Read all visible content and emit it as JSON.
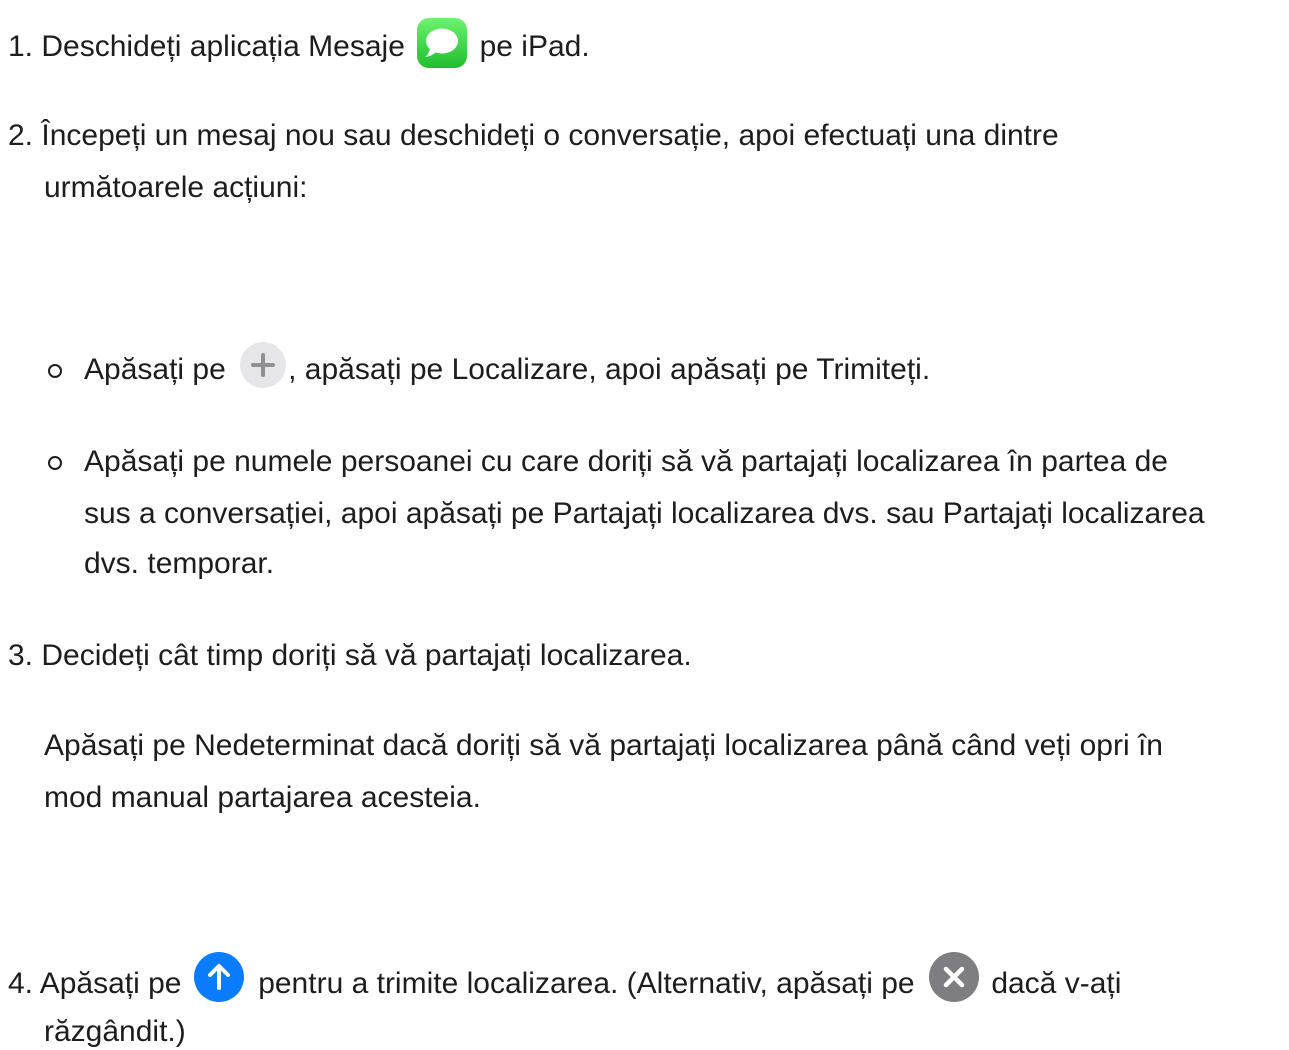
{
  "steps": [
    {
      "number": "1.",
      "before": "Deschideți aplicația Mesaje",
      "icon": "messages-app-icon",
      "after": "pe iPad."
    },
    {
      "number": "2.",
      "line1": "Începeți un mesaj nou sau deschideți o conversație, apoi efectuați una dintre",
      "line2": "următoarele acțiuni:",
      "options": [
        {
          "before": "Apăsați pe",
          "icon": "plus-icon",
          "after": ", apăsați pe Localizare, apoi apăsați pe Trimiteți."
        },
        {
          "line1": "Apăsați pe numele persoanei cu care doriți să vă partajați localizarea în partea de",
          "line2": "sus a conversației, apoi apăsați pe Partajați localizarea dvs. sau Partajați localizarea",
          "line3": "dvs. temporar."
        }
      ]
    },
    {
      "number": "3.",
      "text": "Decideți cât timp doriți să vă partajați localizarea.",
      "note_line1": "Apăsați pe Nedeterminat dacă doriți să vă partajați localizarea până când veți opri în",
      "note_line2": "mod manual partajarea acesteia."
    },
    {
      "number": "4.",
      "before": "Apăsați pe",
      "icon1": "send-arrow-icon",
      "middle": "pentru a trimite localizarea. (Alternativ, apăsați pe",
      "icon2": "cancel-x-icon",
      "after": "dacă v-ați",
      "line2": "răzgândit.)"
    }
  ],
  "colors": {
    "text": "#1d1d1f",
    "messages_green": "#34c759",
    "send_blue": "#0a7cff",
    "cancel_gray": "#7d7d82",
    "plus_bg": "#e6e6e8"
  }
}
